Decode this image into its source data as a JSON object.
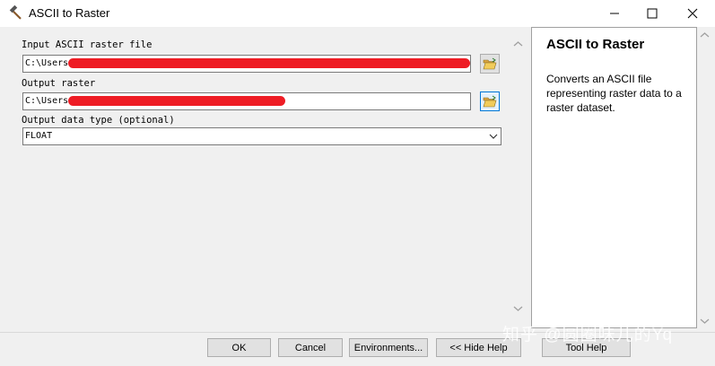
{
  "window": {
    "title": "ASCII to Raster",
    "app_icon": "hammer-icon",
    "minimize_icon": "minimize-icon",
    "maximize_icon": "maximize-icon",
    "close_icon": "close-icon"
  },
  "params": {
    "input": {
      "label": "Input ASCII raster file",
      "value": "C:\\Users",
      "browse_icon": "folder-open-icon"
    },
    "output": {
      "label": "Output raster",
      "value": "C:\\Users",
      "browse_icon": "folder-open-icon"
    },
    "data_type": {
      "label": "Output data type (optional)",
      "selected": "FLOAT"
    }
  },
  "help": {
    "title": "ASCII to Raster",
    "description": "Converts an ASCII file representing raster data to a raster dataset."
  },
  "buttons": {
    "ok": "OK",
    "cancel": "Cancel",
    "environments": "Environments...",
    "hide_help": "<< Hide Help",
    "tool_help": "Tool Help"
  },
  "watermark": "知乎 @圆圈味儿的Yq",
  "colors": {
    "redaction": "#ee1c24",
    "focus_accent": "#0078d7"
  }
}
